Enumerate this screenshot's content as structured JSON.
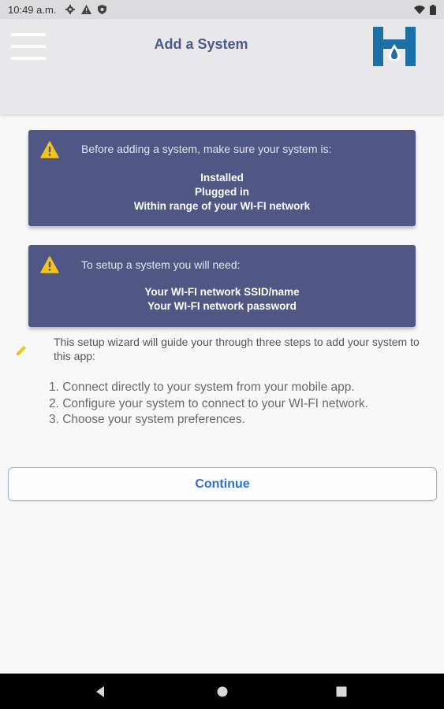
{
  "status_bar": {
    "time": "10:49 a.m.",
    "left_icons": [
      "gear-icon",
      "alert-icon",
      "shield-icon"
    ],
    "right_icons": [
      "wifi-icon",
      "battery-icon"
    ]
  },
  "header": {
    "title": "Add a System",
    "menu_icon": "hamburger-menu-icon",
    "logo": "H-logo",
    "colors": {
      "title": "#4a5a8c",
      "logo": "#1d6fa8"
    }
  },
  "card_before": {
    "icon": "warning-icon",
    "intro": "Before adding a system, make sure your system is:",
    "items": [
      "Installed",
      "Plugged in",
      "Within range of your WI-FI network"
    ]
  },
  "card_needs": {
    "icon": "warning-icon",
    "intro": "To setup a system you will need:",
    "items": [
      "Your WI-FI network SSID/name",
      "Your WI-FI network password"
    ]
  },
  "wizard": {
    "icon": "pencil-icon",
    "text": "This setup wizard will guide your through three steps to add your system to this app:",
    "steps": [
      "1. Connect directly to your system from your mobile app.",
      "2. Configure your system to connect to your WI-FI network.",
      "3. Choose your system preferences."
    ]
  },
  "actions": {
    "continue_label": "Continue"
  },
  "nav_bar": {
    "buttons": [
      "back-icon",
      "home-icon",
      "recents-icon"
    ]
  },
  "colors": {
    "card_bg": "#505784",
    "warning": "#f3c419",
    "accent": "#2f6fcf"
  }
}
